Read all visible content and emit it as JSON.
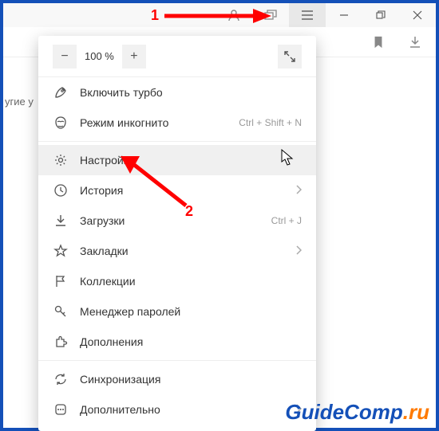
{
  "annotations": {
    "marker1": "1",
    "marker2": "2"
  },
  "clipped_text": "угие у",
  "window": {
    "profile_tooltip": "",
    "tabs_tooltip": ""
  },
  "zoom": {
    "minus": "−",
    "percent": "100 %",
    "plus": "+"
  },
  "menu": {
    "turbo": {
      "label": "Включить турбо"
    },
    "incognito": {
      "label": "Режим инкогнито",
      "shortcut": "Ctrl + Shift + N"
    },
    "settings": {
      "label": "Настройки"
    },
    "history": {
      "label": "История"
    },
    "downloads": {
      "label": "Загрузки",
      "shortcut": "Ctrl + J"
    },
    "bookmarks": {
      "label": "Закладки"
    },
    "collections": {
      "label": "Коллекции"
    },
    "passwords": {
      "label": "Менеджер паролей"
    },
    "addons": {
      "label": "Дополнения"
    },
    "sync": {
      "label": "Синхронизация"
    },
    "more": {
      "label": "Дополнительно"
    }
  },
  "watermark": {
    "main": "GuideComp",
    "suffix": ".ru"
  }
}
